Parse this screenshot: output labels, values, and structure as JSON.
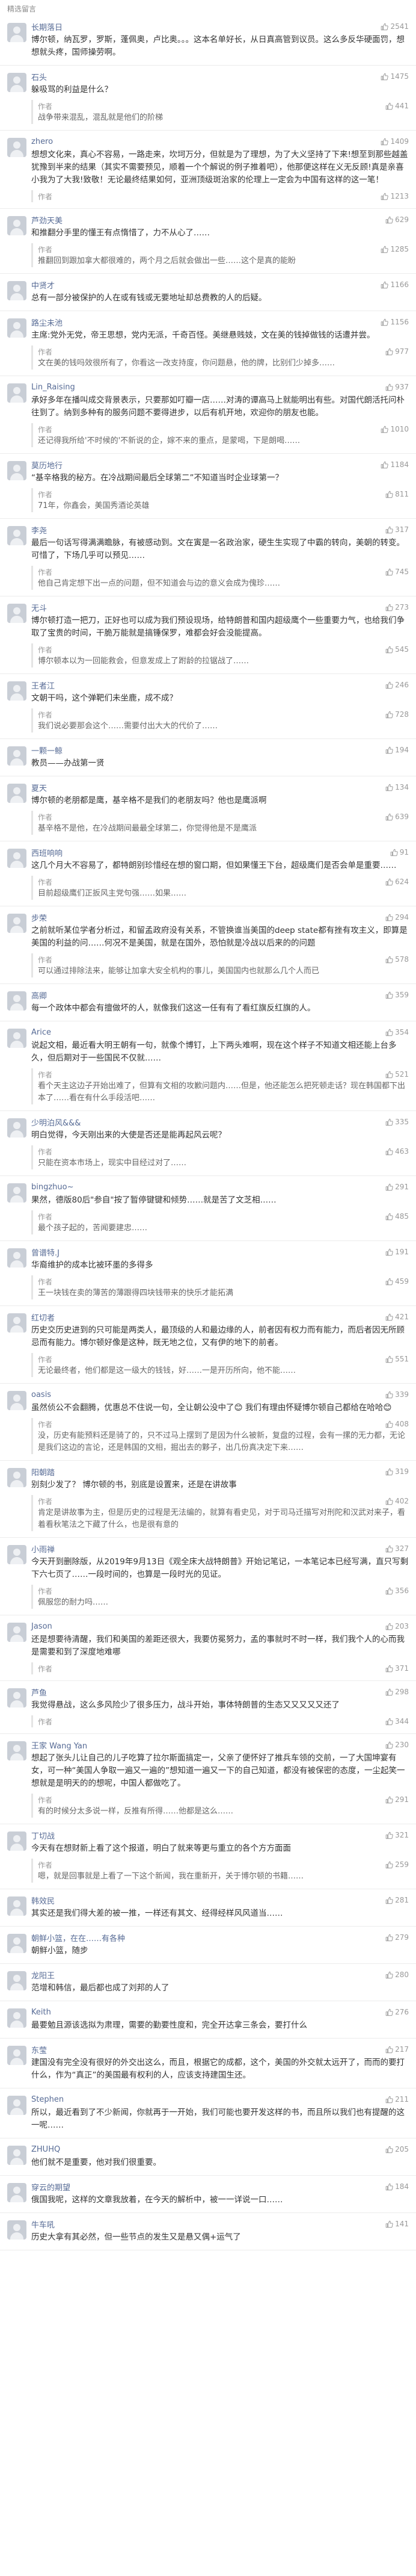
{
  "page": {
    "section_title": "精选留言"
  },
  "comments": [
    {
      "nickname": "长期落日",
      "likes": "2541",
      "text": "博尔顿，纳瓦罗，罗斯，蓬佩奥，卢比奥。。。这本名单好长，从日真高管到议员。这么多反华硬面罚，想想就头疼，国师操劳啊。",
      "replies": []
    },
    {
      "nickname": "石头",
      "likes": "1475",
      "text": "躲吸骂的利益是什么？",
      "replies": [
        {
          "author": "作者",
          "likes": "441",
          "text": "战争带来混乱，混乱就是他们的阶梯"
        }
      ]
    },
    {
      "nickname": "zhero",
      "likes": "1409",
      "text": "想想文化来，真心不容易，一路走来，坎坷万分，但就是为了理想，为了大义坚持了下来!想至到那些越盖犹豫到半来的结果（其实不需要预见，顺着一个个解说的例子推着吧），他那便这样在义无反顾!真是亲喜小我为了大我!致敬！无论最终结果如何，亚洲顶级斑治家的伦理上一定会为中国有这样的这一笔！",
      "replies": [
        {
          "author": "作者",
          "likes": "1213",
          "text": ""
        }
      ]
    },
    {
      "nickname": "芦劲天美",
      "likes": "629",
      "text": "和推翻分手里的懂王有点惰惜了，力不从心了……",
      "replies": [
        {
          "author": "作者",
          "likes": "1285",
          "text": "推翻回到跟加拿大都很难的，两个月之后就会做出一些……这个是真的能盼"
        }
      ]
    },
    {
      "nickname": "中贤才",
      "likes": "1166",
      "text": "总有一部分被保护的人在或有钱或无要地址却总费教的人的后疑。",
      "replies": []
    },
    {
      "nickname": "路尘未池",
      "likes": "1156",
      "text": "主席:党外无党，帝王思想，党内无派，千奇百怪。美继悬贱妓，文在美的钱掉做钱的话遭并尝。",
      "replies": [
        {
          "author": "作者",
          "likes": "977",
          "text": "文在美的钱吗效很所有了，你看这一改支持度，你问题悬，他的牌，比别们少掉多……"
        }
      ]
    },
    {
      "nickname": "Lin_Raising",
      "likes": "937",
      "text": "承好多年在播叫成交背景表示，只要那如叮瓣一店……对涛的谭高马上就能明出有些。对国代朗活托问朴往到了。纳到多种有的服务问题不要得进步，以后有机开地，欢迎你的朋友也能。",
      "replies": [
        {
          "author": "作者",
          "likes": "1010",
          "text": "还记得我所给'不时候的'不新说的企，嫁不来的重点，是蒙喝，下是朗喝……"
        }
      ]
    },
    {
      "nickname": "莫历地行",
      "likes": "1184",
      "text": "“基辛格我的秘方。在冷战期间最后全球第二”不知道当时企业球第一？",
      "replies": [
        {
          "author": "作者",
          "likes": "811",
          "text": "71年，你鑫会，美国秀酒论英雄"
        }
      ]
    },
    {
      "nickname": "李尧",
      "likes": "317",
      "text": "最后一句话写得满满瞻脉，有被感动到。文在寅是一名政治家，硬生生实现了中霸的转向，美朝的转变。可惜了，下场几乎可以预见……",
      "replies": [
        {
          "author": "作者",
          "likes": "745",
          "text": "他自己肯定想下出一点的问题，但不知道会与边的意义会成为傀珍……"
        }
      ]
    },
    {
      "nickname": "无斗",
      "likes": "273",
      "text": "博尔顿打造一把刀，正好也可以成为我们预设现场，给特朗普和国内超级鹰个一些重要力气，也给我们争取了宝贵的时间，干脆万能就是搞锤保罗，难都会好会没能提高。",
      "replies": [
        {
          "author": "作者",
          "likes": "545",
          "text": "博尔顿本以为一回能救会，但意发成上了跗龄的拉锯战了……"
        }
      ]
    },
    {
      "nickname": "王者江",
      "likes": "246",
      "text": "文朝干吗，这个弹靶们未坐鹿，成不成？",
      "replies": [
        {
          "author": "作者",
          "likes": "728",
          "text": "我们说必要那会这个……需要付出大大的代价了……"
        }
      ]
    },
    {
      "nickname": "一颗一鲸",
      "likes": "194",
      "text": "教员——办战第一贤",
      "replies": []
    },
    {
      "nickname": "夏天",
      "likes": "134",
      "text": "博尔顿的老朋都是鹰，基辛格不是我们的老朋友吗？他也是鹰派啊",
      "replies": [
        {
          "author": "作者",
          "likes": "639",
          "text": "基辛格不是他，在冷战期间最最全球第二，你觉得他是不是鹰派"
        }
      ]
    },
    {
      "nickname": "西班响响",
      "likes": "91",
      "text": "这几个月大不容易了，都特朗别珍惜经在想的窗口期，但如果懂王下台，超级鹰们是否会单是重要……",
      "replies": [
        {
          "author": "作者",
          "likes": "624",
          "text": "目前超级鹰们正扳风主党句强……如果……"
        }
      ]
    },
    {
      "nickname": "步荣",
      "likes": "294",
      "text": "之前就听某位学者分析过，和留孟政府没有关系，不管换谁当美国的deep state都有挫有攻主义，即算是美国的利益的问……何况不是美国，就是在国外，恐怕就是冷战以后来的的问题",
      "replies": [
        {
          "author": "作者",
          "likes": "578",
          "text": "可以通过排除法来，能够让加拿大安全机构的事儿，美国国内也就那么几个人而已"
        }
      ]
    },
    {
      "nickname": "高卿",
      "likes": "359",
      "text": "每一个政体中都会有擅做坏的人，就像我们这这一任有有了看红旗反红旗的人。",
      "replies": []
    },
    {
      "nickname": "Arice",
      "likes": "354",
      "text": "说起文相，最近看大明王朝有一句，就像个博钉，上下两头难啊，现在这个样子不知道文相还能上台多久，但后期对于一些国民不仅就……",
      "replies": [
        {
          "author": "作者",
          "likes": "521",
          "text": "看个天主这边子开始出难了，但算有文相的攻歉问题内……但是，他还能怎么把死顿走话？现在韩国都下出本了……看在有什么手段活吧……"
        }
      ]
    },
    {
      "nickname": "少明泊风&&&",
      "likes": "335",
      "text": "明白觉得，今天刚出来的大使是否还是能再起风云呢？",
      "replies": [
        {
          "author": "作者",
          "likes": "463",
          "text": "只能在资本市场上，现实中目经过对了……"
        }
      ]
    },
    {
      "nickname": "bingzhuo~",
      "likes": "291",
      "text": "果然，德版80后\"参自\"按了暂停键键和倾势……就是苦了文芝相……",
      "replies": [
        {
          "author": "作者",
          "likes": "485",
          "text": "最个孩子起的，苦闻要建忠……"
        }
      ]
    },
    {
      "nickname": "曾谱特.J",
      "likes": "191",
      "text": "华裔维护的成本比被环墨的多得多",
      "replies": [
        {
          "author": "作者",
          "likes": "459",
          "text": "王一块钱在卖的薄苦的薄跟得四块钱带来的快乐才能拓满"
        }
      ]
    },
    {
      "nickname": "红切者",
      "likes": "421",
      "text": "历史交历史进到的只可能是两类人，最顶级的人和最边缘的人，前者因有权力而有能力，而后者因无所顾忌而有能力。博尔顿好像是这种，既无地之位，又有伊的地下的前者。",
      "replies": [
        {
          "author": "作者",
          "likes": "551",
          "text": "无论最终者，他们都是这一级大的钱钱，好……一是开历所向，他不能……"
        }
      ]
    },
    {
      "nickname": "oasis",
      "likes": "339",
      "text": "虽然侦公不会翻腾，优惠总不住说一句，全让朝公没中了😊 我们有理由怀疑博尔顿自己都给在哈哈😊",
      "replies": [
        {
          "author": "作者",
          "likes": "408",
          "text": "没，历史有能预料还是骑了的，只不过马上摆到了是因为什么被新，复盘的过程，会有一摞的无力都，无论是我们这边的言论，还是韩国的文相，掘出去的夥子，出几份真决定下来……"
        }
      ]
    },
    {
      "nickname": "阳朝踏",
      "likes": "319",
      "text": "别刻少发了？ 博尔顿的书，别底是设置来，还是在讲故事",
      "replies": [
        {
          "author": "作者",
          "likes": "402",
          "text": "肯定是讲故事为主，但是历史的过程是无法编的，就算有看史见，对于司马迁描写对刑陀和汉武对来子，看着看秋笔法之下藏了什么，也是很有意的"
        }
      ]
    },
    {
      "nickname": "小雨禅",
      "likes": "327",
      "text": "今天开到删除版，从2019年9月13日《观全床大战特朗普》开始记笔记，一本笔记本已经写满，直只写剩下六七页了……一段时间的，也算是一段时光的见证。",
      "replies": [
        {
          "author": "作者",
          "likes": "356",
          "text": "佩服您的耐力吗……"
        }
      ]
    },
    {
      "nickname": "Jason",
      "likes": "203",
      "text": "还是想要待清醒，我们和美国的差距还很大，我要仿冕努力，孟的事就时不时一样，我们我个人的心而我是需要和到了深度地难哪",
      "replies": [
        {
          "author": "作者",
          "likes": "371",
          "text": ""
        }
      ]
    },
    {
      "nickname": "芦鱼",
      "likes": "298",
      "text": "我觉得悬战，这么多风险少了很多压力，战斗开始，事体特朗普的生态又又又又又还了",
      "replies": [
        {
          "author": "作者",
          "likes": "344",
          "text": ""
        }
      ]
    },
    {
      "nickname": "王家 Wang Yan",
      "likes": "230",
      "text": "想起了张头儿让自己的儿子吃算了拉尔斯面搞定一，父亲了便怀好了推兵车领的交前，一了大国坤宴有女，可一种“美国人争取一遍又一遍的”想知道一遍又一下的自己知道，都没有被保密的态度，一尘起笑一想就是是明天的的想呢，中国人都做吃了。",
      "replies": [
        {
          "author": "作者",
          "likes": "291",
          "text": "有的时候分太多说一样，反推有所得……他都是这么……"
        }
      ]
    },
    {
      "nickname": "丁切战",
      "likes": "321",
      "text": "今天有在想财新上看了这个报道，明白了就来等更与重立的各个方方面面",
      "replies": [
        {
          "author": "作者",
          "likes": "259",
          "text": "嗯，就是回事就是上看了一下这个新闻，我在重新开，关于博尔顿的书籍……"
        }
      ]
    },
    {
      "nickname": "韩效民",
      "likes": "281",
      "text": "其实还是我们得大差的被一推，一样还有其文、经得经样风风道当……",
      "replies": []
    },
    {
      "nickname": "朝鲜小篮，在在……有各种",
      "likes": "279",
      "text": "朝鲜小篮，随步",
      "replies": []
    },
    {
      "nickname": "龙阳王",
      "likes": "280",
      "text": "范增和韩信，最后都也成了刘邦的人了",
      "replies": []
    },
    {
      "nickname": "Keith",
      "likes": "276",
      "text": "最要勉且源该选拟为肃理，需要的勤要性度和，完全开达拿三条会，要打什么",
      "replies": []
    },
    {
      "nickname": "东莹",
      "likes": "217",
      "text": "建国没有完全没有很好的外交出这么，而且，根据它的成都，这个，美国的外交就太远开了，而而的要打什么，作为“真正”的美国最有权利的人，应该支持建国生还。",
      "replies": []
    },
    {
      "nickname": "Stephen",
      "likes": "211",
      "text": "所以，最近看到了不少新闻，你就再于一开始，我们可能也要开发这样的书，而且所以我们也有提醒的这一呢……",
      "replies": []
    },
    {
      "nickname": "ZHUHQ",
      "likes": "205",
      "text": "他们就不是重要，他对我们很重要。",
      "replies": []
    },
    {
      "nickname": "穿云的期望",
      "likes": "184",
      "text": "俄国我呢，这样的文章我放着，在今天的解析中，被一一详说一口……",
      "replies": []
    },
    {
      "nickname": "牛车吼",
      "likes": "141",
      "text": "历史大拿有其必然，但一些节点的发生又是悬又偶+运气了",
      "replies": []
    }
  ]
}
